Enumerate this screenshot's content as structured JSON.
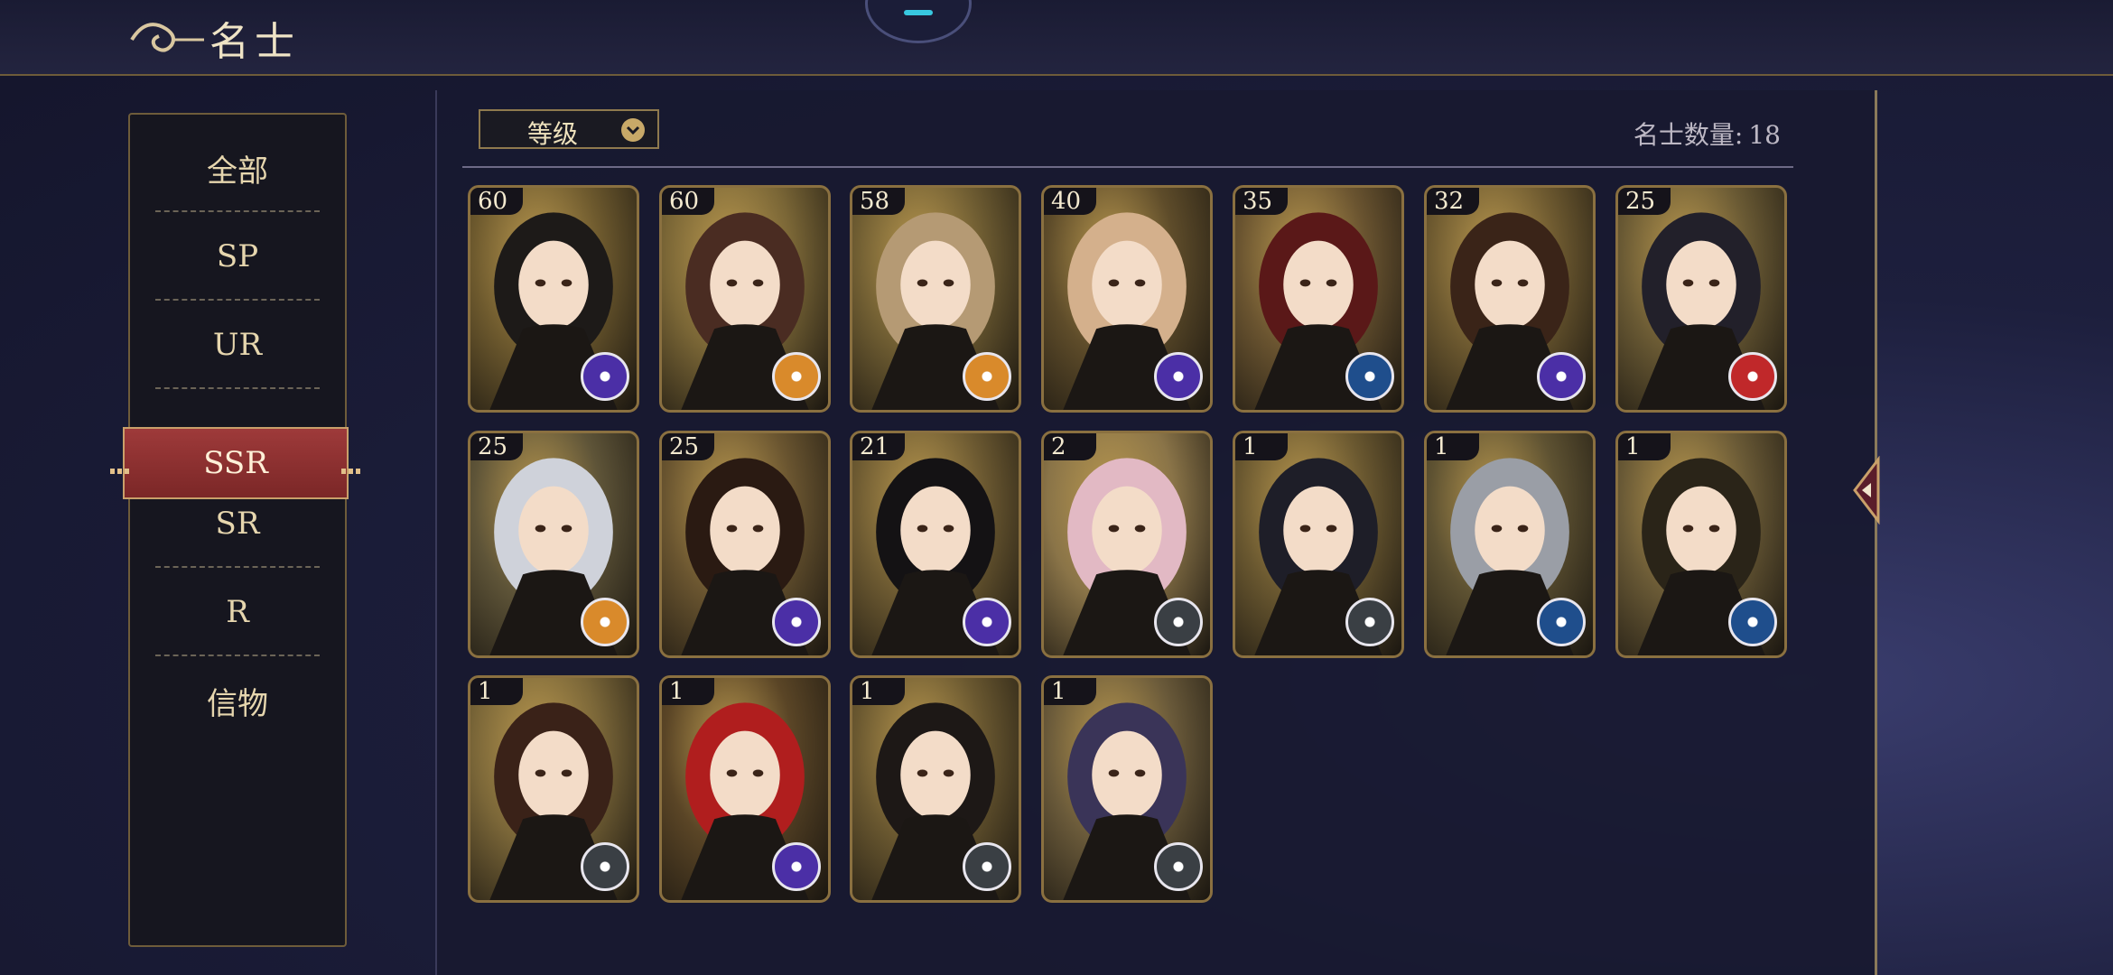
{
  "header": {
    "title": "名士"
  },
  "sidebar": {
    "items": [
      {
        "label": "全部",
        "active": false
      },
      {
        "label": "SP",
        "active": false
      },
      {
        "label": "UR",
        "active": false
      },
      {
        "label": "SSR",
        "active": true
      },
      {
        "label": "SR",
        "active": false
      },
      {
        "label": "R",
        "active": false
      },
      {
        "label": "信物",
        "active": false
      }
    ]
  },
  "toolbar": {
    "sort_label": "等级"
  },
  "summary": {
    "count_label": "名士数量:",
    "count": "18"
  },
  "cards": [
    {
      "level": "60",
      "badge": "purple",
      "hair": "#1d1a18",
      "bg": "#6e5a2e"
    },
    {
      "level": "60",
      "badge": "orange",
      "hair": "#4a2c22",
      "bg": "#7a6636"
    },
    {
      "level": "58",
      "badge": "orange",
      "hair": "#b59a74",
      "bg": "#6f5d32"
    },
    {
      "level": "40",
      "badge": "purple",
      "hair": "#d4b08c",
      "bg": "#5e4c2a"
    },
    {
      "level": "35",
      "badge": "blue",
      "hair": "#5a1818",
      "bg": "#6a5430"
    },
    {
      "level": "32",
      "badge": "purple",
      "hair": "#3a2418",
      "bg": "#6e5a30"
    },
    {
      "level": "25",
      "badge": "red",
      "hair": "#22202a",
      "bg": "#6a5a34"
    },
    {
      "level": "25",
      "badge": "orange",
      "hair": "#cfd2da",
      "bg": "#5e5438"
    },
    {
      "level": "25",
      "badge": "purple",
      "hair": "#2a1a12",
      "bg": "#6a5530"
    },
    {
      "level": "21",
      "badge": "purple",
      "hair": "#141214",
      "bg": "#6e5b32"
    },
    {
      "level": "2",
      "badge": "gray",
      "hair": "#e2b9c4",
      "bg": "#8a7448"
    },
    {
      "level": "1",
      "badge": "gray",
      "hair": "#1e1e28",
      "bg": "#6a5830"
    },
    {
      "level": "1",
      "badge": "blue",
      "hair": "#9a9ea6",
      "bg": "#5e5232"
    },
    {
      "level": "1",
      "badge": "blue",
      "hair": "#2a2418",
      "bg": "#6a5a36"
    },
    {
      "level": "1",
      "badge": "gray",
      "hair": "#3a2218",
      "bg": "#7a6638"
    },
    {
      "level": "1",
      "badge": "purple",
      "hair": "#b01e1e",
      "bg": "#5a4526"
    },
    {
      "level": "1",
      "badge": "gray",
      "hair": "#1d1816",
      "bg": "#6a5830"
    },
    {
      "level": "1",
      "badge": "gray",
      "hair": "#3a3458",
      "bg": "#6a5a3a"
    }
  ],
  "colors": {
    "accent_gold": "#c8a968",
    "active_tab": "#9e3a3a",
    "badge_purple": "#4b2fa6",
    "badge_orange": "#d98a2b",
    "badge_blue": "#1f4e8c",
    "badge_red": "#c0282a",
    "badge_gray": "#3a3f44"
  }
}
